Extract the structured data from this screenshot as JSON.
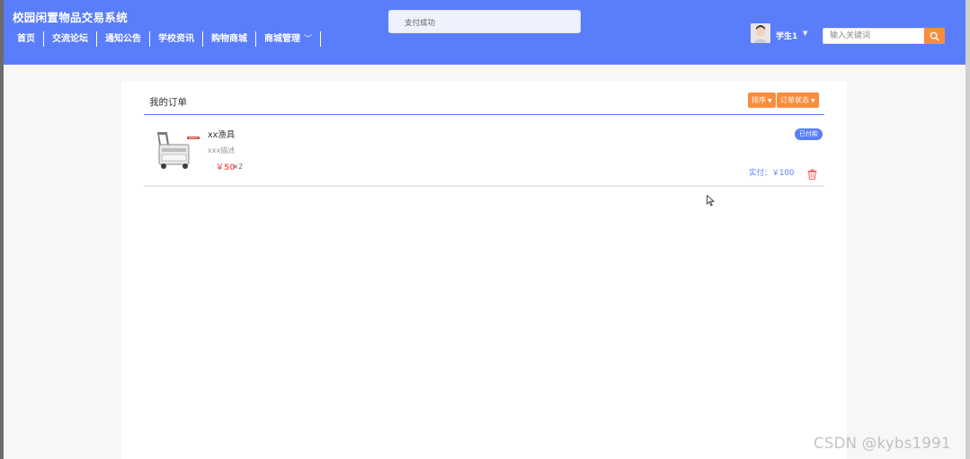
{
  "header": {
    "site_title": "校园闲置物品交易系统",
    "nav": [
      "首页",
      "交流论坛",
      "通知公告",
      "学校资讯",
      "购物商城",
      "商城管理"
    ],
    "user": {
      "name": "学生1"
    },
    "search": {
      "placeholder": "输入关键词"
    }
  },
  "toast": {
    "message": "支付成功"
  },
  "orders_page": {
    "title": "我的订单",
    "sort_label": "排序",
    "status_filter_label": "订单状态",
    "orders": [
      {
        "name": "xx渔具",
        "description": "xxx描述",
        "price": "￥50",
        "quantity": "×2",
        "status": "已付款",
        "paid_amount": "实付：￥100"
      }
    ]
  },
  "watermark": "CSDN @kybs1991",
  "colors": {
    "header_bg": "#5a7dfb",
    "accent_orange": "#fb8c3c",
    "price_red": "#f56c6c",
    "delete_red": "#f56c6c"
  },
  "icons": [
    "chevron-down-icon",
    "caret-down-icon",
    "search-icon",
    "delete-icon",
    "mouse-cursor-icon"
  ]
}
